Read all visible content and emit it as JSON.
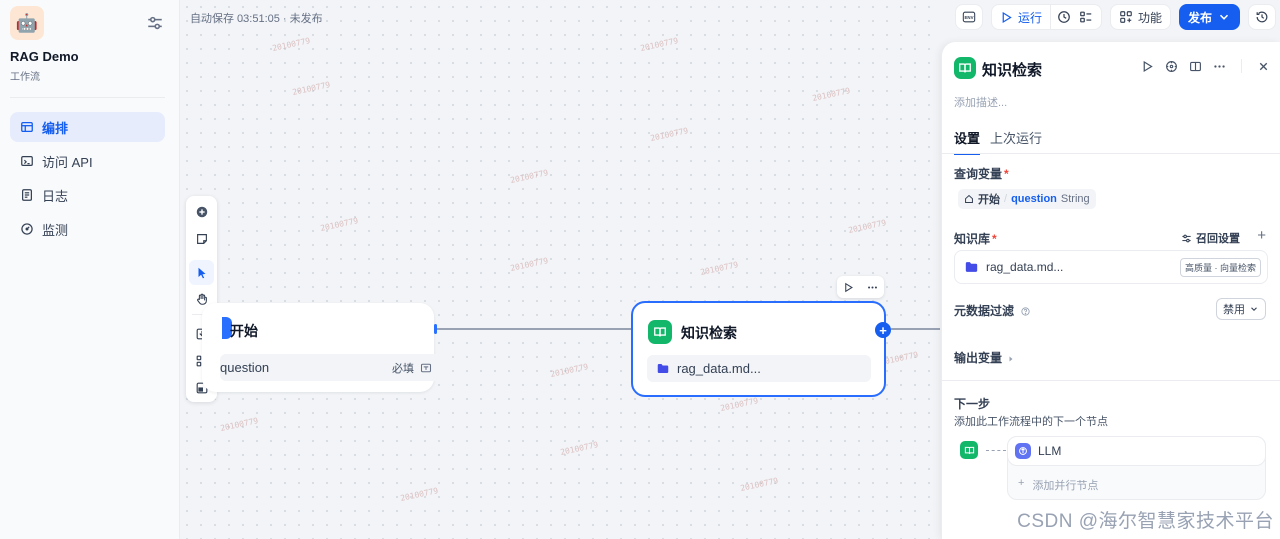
{
  "app": {
    "icon": "robot-emoji",
    "name": "RAG Demo",
    "type": "工作流"
  },
  "nav": [
    {
      "label": "编排",
      "icon": "layout-icon",
      "active": true
    },
    {
      "label": "访问 API",
      "icon": "terminal-icon",
      "active": false
    },
    {
      "label": "日志",
      "icon": "file-list-icon",
      "active": false
    },
    {
      "label": "监测",
      "icon": "gauge-icon",
      "active": false
    }
  ],
  "canvas": {
    "autosave": "自动保存 03:51:05 · 未发布",
    "watermark": "20100779",
    "start_node": {
      "title": "开始",
      "var_name": "question",
      "required": "必填"
    },
    "kb_node": {
      "title": "知识检索",
      "dataset": "rag_data.md..."
    }
  },
  "topbar": {
    "env": "ENV",
    "run": "运行",
    "features": "功能",
    "publish": "发布"
  },
  "panel": {
    "title": "知识检索",
    "desc_placeholder": "添加描述...",
    "tabs": [
      "设置",
      "上次运行"
    ],
    "query_label": "查询变量",
    "query_source": "开始",
    "query_var": "question",
    "query_type": "String",
    "kb_label": "知识库",
    "recall_label": "召回设置",
    "dataset": "rag_data.md...",
    "dataset_badge": "高质量 · 向量检索",
    "meta_label": "元数据过滤",
    "meta_value": "禁用",
    "output_label": "输出变量",
    "next_label": "下一步",
    "next_sub": "添加此工作流程中的下一个节点",
    "next_node": "LLM",
    "add_parallel": "添加并行节点"
  },
  "footer_watermark": "CSDN @海尔智慧家技术平台",
  "colors": {
    "accent": "#155eef",
    "kb_green": "#12b76a",
    "llm": "#6172f3"
  }
}
